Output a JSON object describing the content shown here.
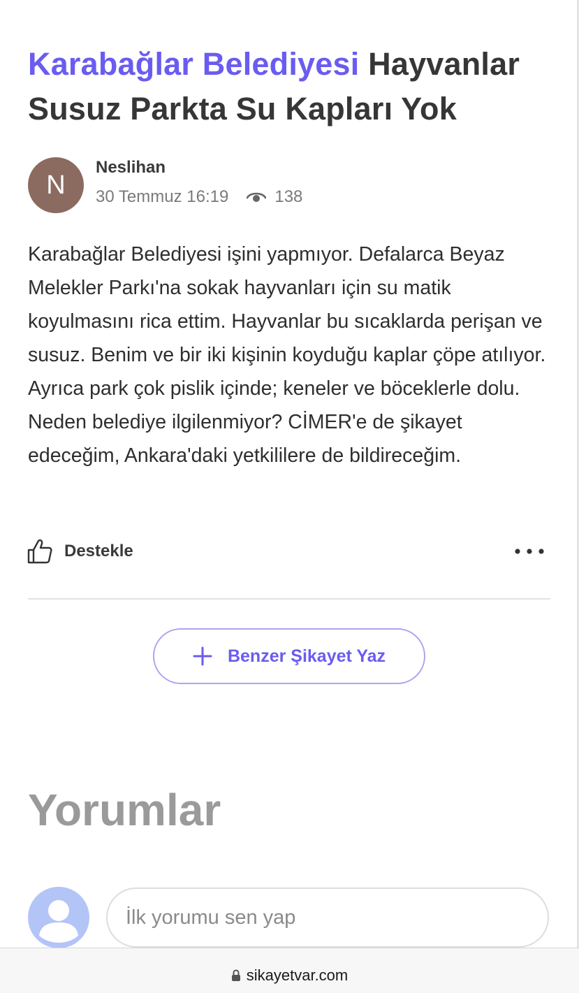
{
  "complaint": {
    "brand": "Karabağlar Belediyesi",
    "title": "Hayvanlar Susuz Parkta Su Kapları Yok",
    "body": "Karabağlar Belediyesi işini yapmıyor. Defalarca Beyaz Melekler Parkı'na sokak hayvanları için su matik koyulmasını rica ettim. Hayvanlar bu sıcaklarda perişan ve susuz. Benim ve bir iki kişinin koyduğu kaplar çöpe atılıyor. Ayrıca park çok pislik içinde; keneler ve böceklerle dolu. Neden belediye ilgilenmiyor? CİMER'e de şikayet edeceğim, Ankara'daki yetkililere de bildireceğim."
  },
  "author": {
    "initial": "N",
    "name": "Neslihan",
    "date": "30 Temmuz 16:19",
    "views": "138",
    "avatar_color": "#8b6b60",
    "view_icon": "eye-icon"
  },
  "actions": {
    "support_label": "Destekle",
    "support_icon": "thumbs-up-icon",
    "more_icon": "more-dots-icon",
    "similar_label": "Benzer Şikayet Yaz",
    "similar_icon": "plus-icon"
  },
  "comments": {
    "title": "Yorumlar",
    "input_placeholder": "İlk yorumu sen yap",
    "user_icon": "user-avatar-icon"
  },
  "browser": {
    "url": "sikayetvar.com",
    "lock_icon": "lock-icon"
  },
  "colors": {
    "accent": "#6a5cf0",
    "button_border": "#aaa5f0",
    "avatar_placeholder": "#b3c4f7"
  }
}
